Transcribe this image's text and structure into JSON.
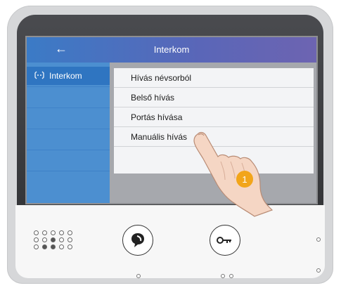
{
  "screen": {
    "header": {
      "back_icon": "arrow-left-icon",
      "title": "Interkom"
    },
    "sidebar": {
      "items": [
        {
          "icon": "intercom-icon",
          "label": "Interkom"
        }
      ]
    },
    "menu": {
      "items": [
        {
          "label": "Hívás névsorból"
        },
        {
          "label": "Belső hívás"
        },
        {
          "label": "Portás hívása"
        },
        {
          "label": "Manuális hívás"
        }
      ]
    }
  },
  "device": {
    "buttons": [
      {
        "icon": "talk-icon"
      },
      {
        "icon": "key-icon"
      }
    ]
  },
  "annotation": {
    "step_number": "1"
  },
  "colors": {
    "header_start": "#3b7bc6",
    "header_end": "#6d64b1",
    "sidebar": "#4c8fd0",
    "selected": "#2f75c1",
    "badge": "#f2a51a"
  }
}
